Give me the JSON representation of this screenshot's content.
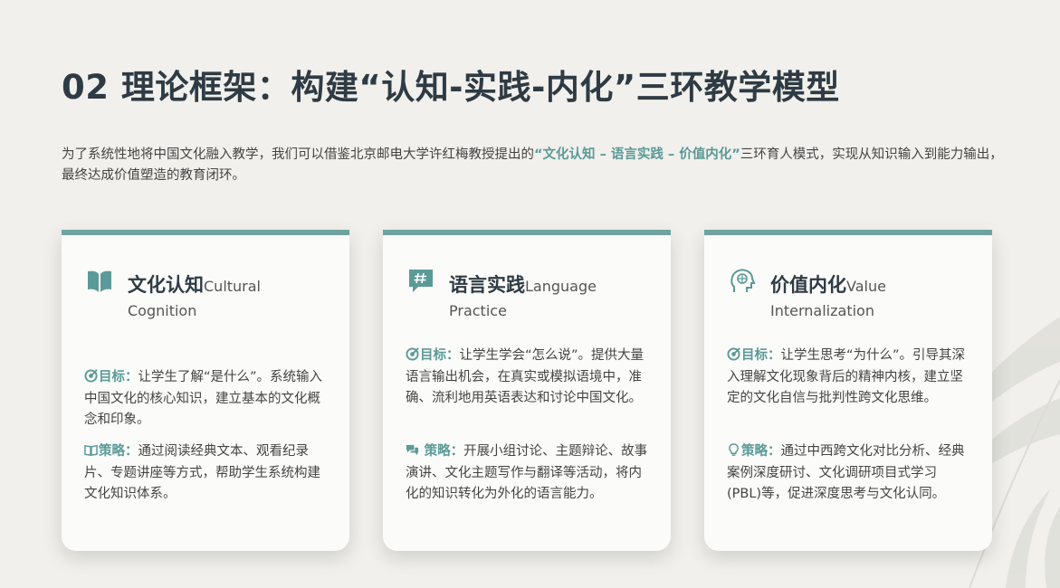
{
  "page": {
    "title": "02 理论框架：构建“认知-实践-内化”三环教学模型",
    "intro_before": "为了系统性地将中国文化融入教学，我们可以借鉴北京邮电大学许红梅教授提出的",
    "intro_highlight": "“文化认知 – 语言实践 – 价值内化”",
    "intro_after": "三环育人模式，实现从知识输入到能力输出，最终达成价值塑造的教育闭环。"
  },
  "colors": {
    "accent": "#6fa3a0",
    "accent_text": "#5b9a97",
    "title": "#2f3b44",
    "background": "#f1f0ec"
  },
  "cards": [
    {
      "icon": "open-book-icon",
      "title_zh": "文化认知",
      "title_en_1": "Cultural",
      "title_en_2": "Cognition",
      "goal_icon": "target-icon",
      "goal_label": "目标：",
      "goal_text": "让学生了解“是什么”。系统输入中国文化的核心知识，建立基本的文化概念和印象。",
      "strategy_icon": "book-icon",
      "strategy_label": "策略：",
      "strategy_text": "通过阅读经典文本、观看纪录片、专题讲座等方式，帮助学生系统构建文化知识体系。"
    },
    {
      "icon": "hashtag-chat-icon",
      "title_zh": "语言实践",
      "title_en_1": "Language",
      "title_en_2": "Practice",
      "goal_icon": "target-icon",
      "goal_label": "目标：",
      "goal_text": "让学生学会“怎么说”。提供大量语言输出机会，在真实或模拟语境中，准确、流利地用英语表达和讨论中国文化。",
      "strategy_icon": "comments-icon",
      "strategy_label": "策略：",
      "strategy_text": "开展小组讨论、主题辩论、故事演讲、文化主题写作与翻译等活动，将内化的知识转化为外化的语言能力。"
    },
    {
      "icon": "brain-head-icon",
      "title_zh": "价值内化",
      "title_en_1": "Value",
      "title_en_2": "Internalization",
      "goal_icon": "target-icon",
      "goal_label": "目标：",
      "goal_text": "让学生思考“为什么”。引导其深入理解文化现象背后的精神内核，建立坚定的文化自信与批判性跨文化思维。",
      "strategy_icon": "lightbulb-icon",
      "strategy_label": "策略：",
      "strategy_text": "通过中西跨文化对比分析、经典案例深度研讨、文化调研项目式学习(PBL)等，促进深度思考与文化认同。"
    }
  ]
}
